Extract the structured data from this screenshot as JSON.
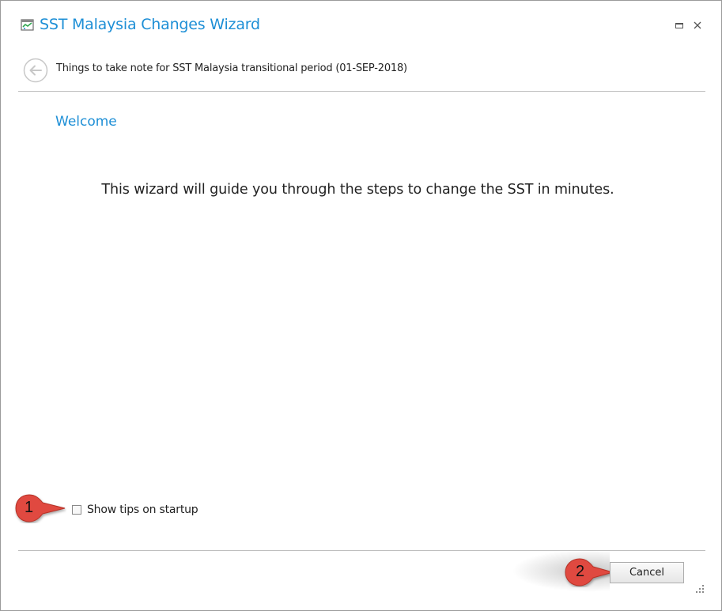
{
  "window": {
    "title": "SST Malaysia Changes Wizard",
    "accent_color": "#1e8fd6"
  },
  "header": {
    "step_title": "Things to take note for SST Malaysia transitional period (01-SEP-2018)"
  },
  "content": {
    "heading": "Welcome",
    "message": "This wizard will guide you through the steps to change the SST in minutes."
  },
  "options": {
    "show_tips_label": "Show tips on startup",
    "show_tips_checked": false
  },
  "footer": {
    "cancel_label": "Cancel"
  },
  "annotations": {
    "callout_1": "1",
    "callout_2": "2",
    "callout_color": "#e04a3f"
  },
  "icons": {
    "title": "wizard-app-icon",
    "maximize": "maximize-icon",
    "close": "close-icon",
    "back": "back-arrow-icon",
    "resize": "resize-grip-icon"
  }
}
